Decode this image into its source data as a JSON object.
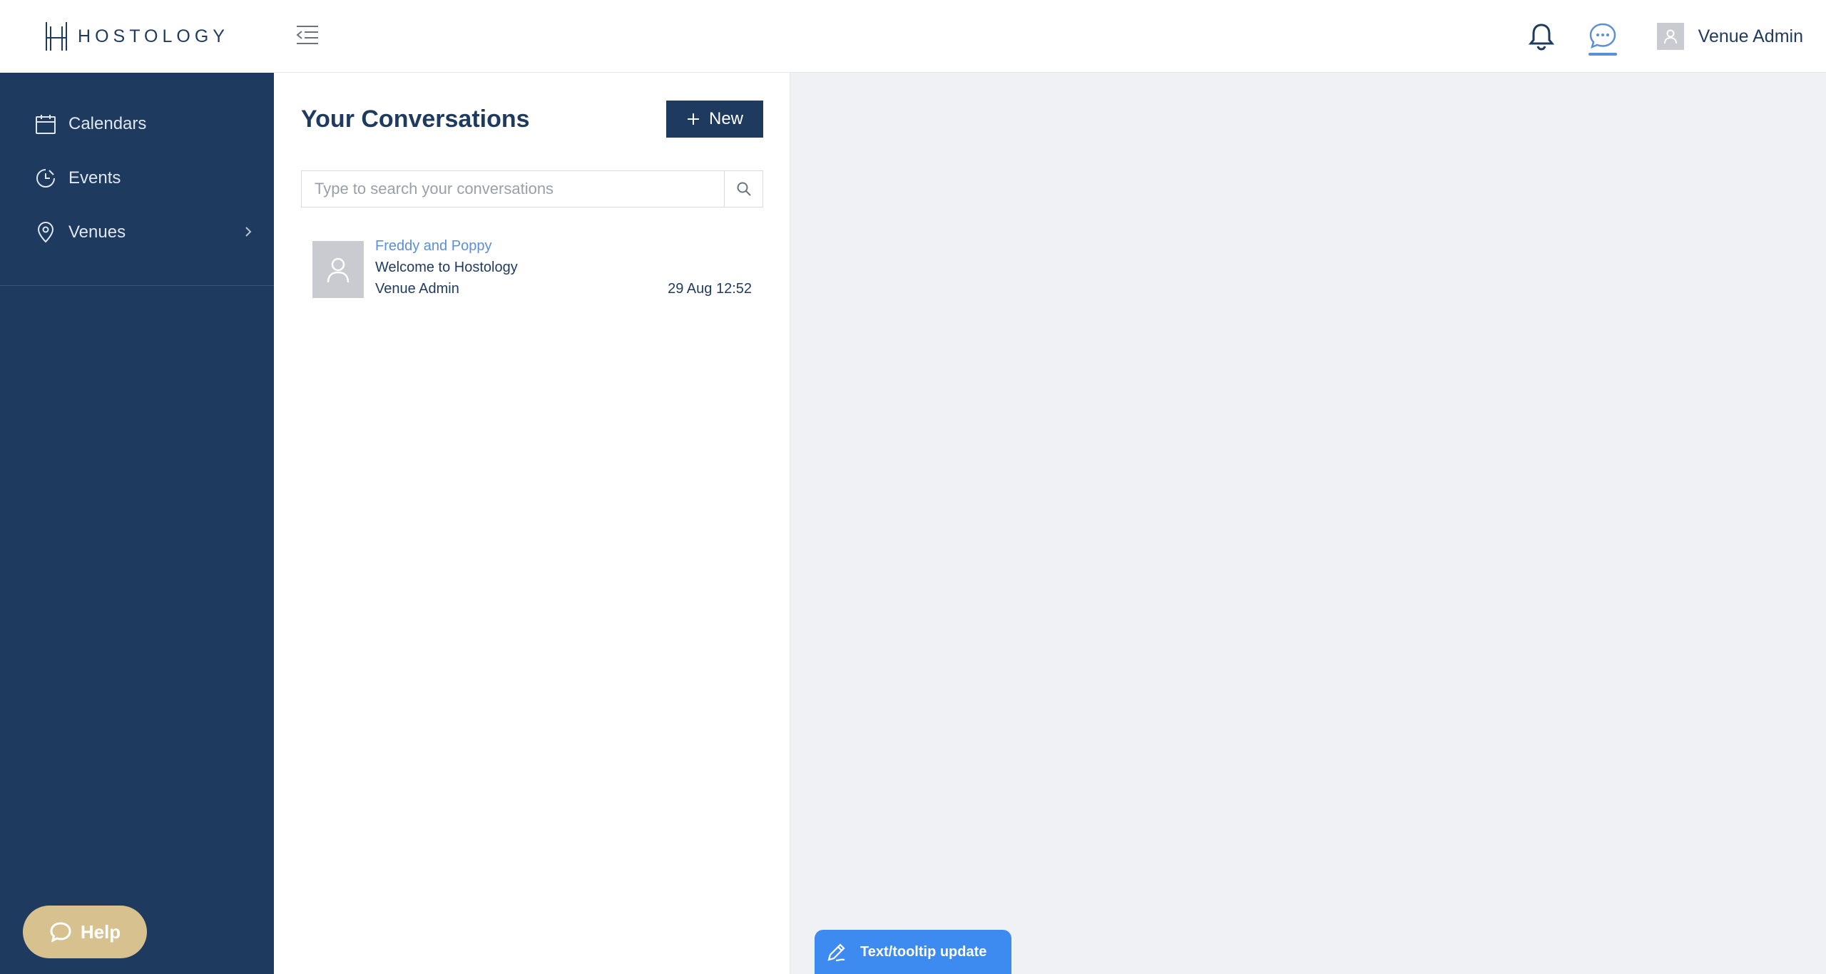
{
  "brand": {
    "name": "HOSTOLOGY"
  },
  "sidebar": {
    "items": [
      {
        "label": "Calendars",
        "icon": "calendar-icon"
      },
      {
        "label": "Events",
        "icon": "clock-icon"
      },
      {
        "label": "Venues",
        "icon": "location-pin-icon",
        "has_children": true
      }
    ],
    "help_label": "Help"
  },
  "topbar": {
    "user_name": "Venue Admin"
  },
  "conversations": {
    "title": "Your Conversations",
    "new_label": "New",
    "search_placeholder": "Type to search your conversations",
    "items": [
      {
        "name": "Freddy and Poppy",
        "subject": "Welcome to Hostology",
        "sender": "Venue Admin",
        "time": "29 Aug 12:52"
      }
    ]
  },
  "feedback": {
    "label": "Text/tooltip update"
  },
  "colors": {
    "sidebar_bg": "#1f3a5f",
    "accent_blue": "#5b8fd8",
    "help_gold": "#d6c18f",
    "feedback_blue": "#3d8bf0"
  }
}
